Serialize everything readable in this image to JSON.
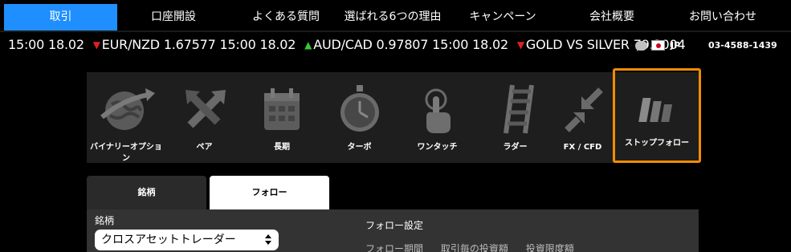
{
  "nav": {
    "items": [
      {
        "label": "取引",
        "active": true
      },
      {
        "label": "口座開設"
      },
      {
        "label": "よくある質問"
      },
      {
        "label": "選ばれる6つの理由"
      },
      {
        "label": "キャンペーン"
      },
      {
        "label": "会社概要"
      },
      {
        "label": "お問い合わせ"
      }
    ]
  },
  "ticker": {
    "segments": [
      {
        "time": "15:00 18.02"
      },
      {
        "direction": "down",
        "pair": "EUR/NZD",
        "value": "1.67577",
        "time": "15:00 18.02"
      },
      {
        "direction": "up",
        "pair": "AUD/CAD",
        "value": "0.97807",
        "time": "15:00 18.02"
      },
      {
        "direction": "down",
        "pair": "GOLD VS SILVER",
        "value": "79.1004"
      }
    ],
    "lang": "JP",
    "phone": "03-4588-1439"
  },
  "products": [
    {
      "label": "バイナリーオプショ\nン",
      "icon": "globe-arrow-icon"
    },
    {
      "label": "ペア",
      "icon": "crossed-arrows-icon"
    },
    {
      "label": "長期",
      "icon": "calendar-icon"
    },
    {
      "label": "ターボ",
      "icon": "stopwatch-icon"
    },
    {
      "label": "ワンタッチ",
      "icon": "touch-hand-icon"
    },
    {
      "label": "ラダー",
      "icon": "ladder-icon"
    },
    {
      "label": "FX / CFD",
      "icon": "converging-arrows-icon"
    },
    {
      "label": "ストップフォロー",
      "icon": "steps-icon",
      "selected": true
    }
  ],
  "tabs": {
    "brand": "銘柄",
    "follow": "フォロー"
  },
  "form": {
    "brand_label": "銘柄",
    "brand_value": "クロスアセットトレーダー",
    "follow_title": "フォロー設定",
    "columns": [
      "フォロー期間",
      "取引毎の投資額",
      "投資限度額"
    ]
  },
  "colors": {
    "active_nav": "#1f8fff",
    "selected_outline": "#f28c00",
    "down": "#e02020",
    "up": "#37c837"
  }
}
